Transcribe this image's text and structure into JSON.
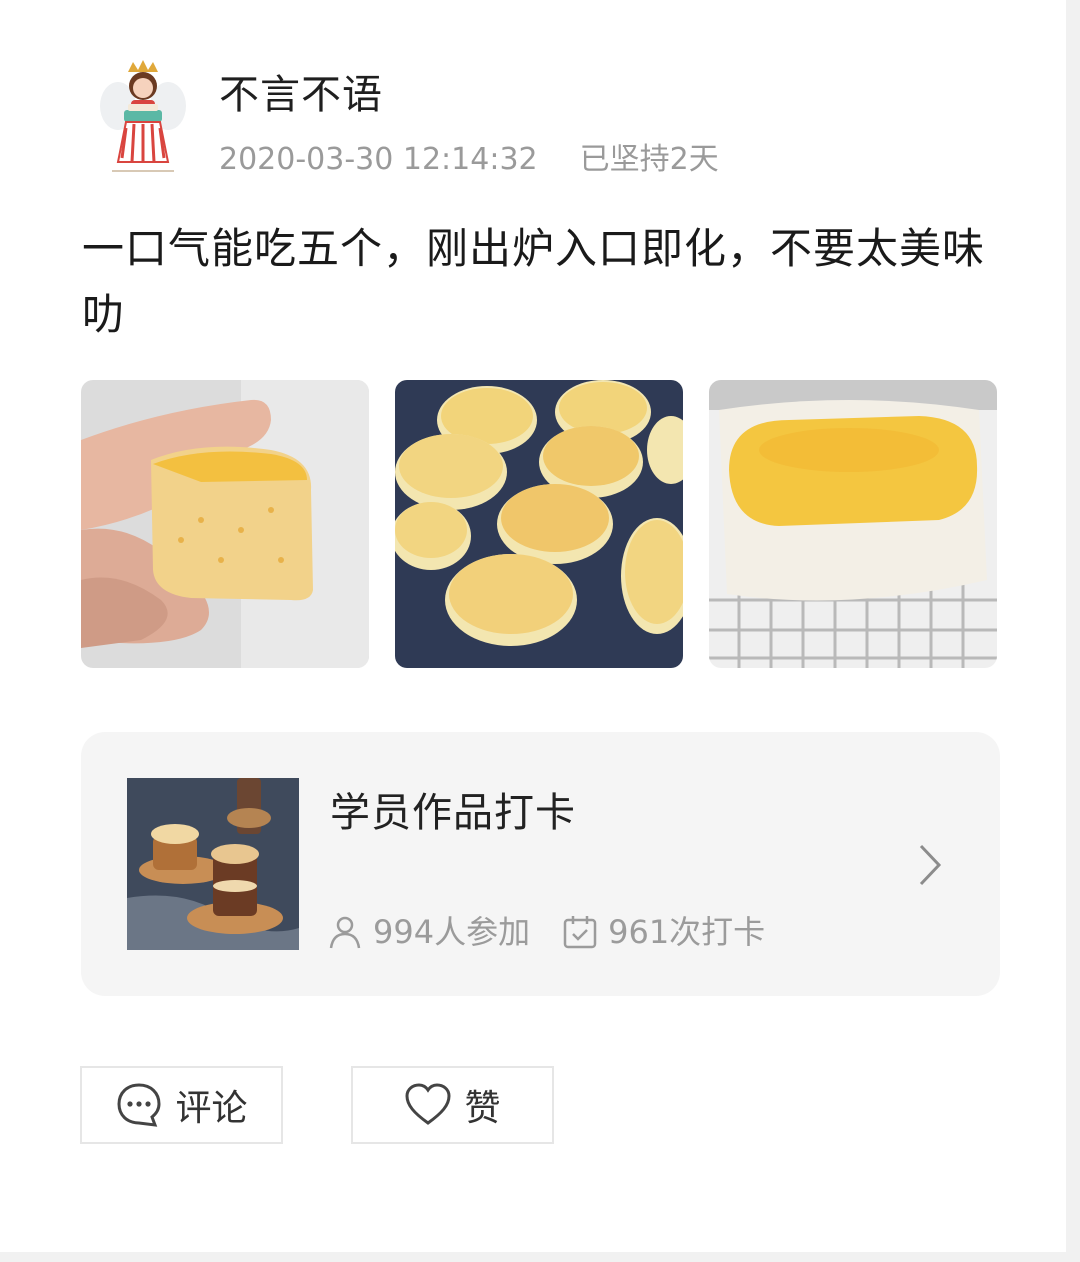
{
  "post": {
    "username": "不言不语",
    "timestamp": "2020-03-30 12:14:32",
    "streak": "已坚持2天",
    "text": "一口气能吃五个，刚出炉入口即化，不要太美味叻",
    "photos": [
      "photo-cake-held-in-hand",
      "photo-cakes-on-tray",
      "photo-cake-in-paper-cup"
    ]
  },
  "challenge": {
    "title": "学员作品打卡",
    "participants": "994人参加",
    "checkins": "961次打卡"
  },
  "actions": {
    "comment_label": "评论",
    "like_label": "赞"
  },
  "colors": {
    "card_bg": "#f5f5f5",
    "muted_text": "#9a9a9a",
    "border": "#e6e6e6"
  }
}
